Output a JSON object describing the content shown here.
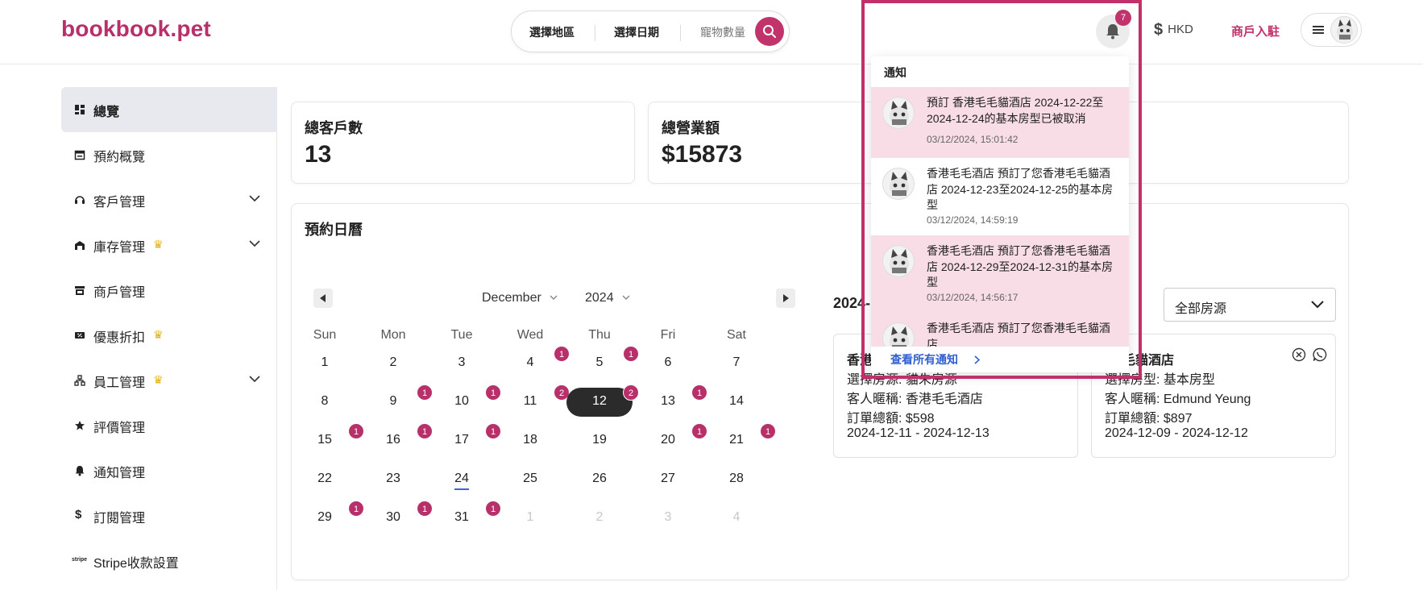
{
  "header": {
    "logo": "bookbook.pet",
    "search": {
      "region_label": "選擇地區",
      "date_label": "選擇日期",
      "pets_placeholder": "寵物數量"
    },
    "notification_count": "7",
    "currency": "HKD",
    "merchant_link": "商戶入駐"
  },
  "sidebar": {
    "items": [
      {
        "label": "總覽",
        "icon": "dashboard-icon",
        "active": true
      },
      {
        "label": "預約概覽",
        "icon": "calendar-icon"
      },
      {
        "label": "客戶管理",
        "icon": "headset-icon",
        "expandable": true
      },
      {
        "label": "庫存管理",
        "icon": "garage-icon",
        "premium": true,
        "expandable": true
      },
      {
        "label": "商戶管理",
        "icon": "store-icon"
      },
      {
        "label": "優惠折扣",
        "icon": "discount-icon",
        "premium": true
      },
      {
        "label": "員工管理",
        "icon": "org-icon",
        "premium": true,
        "expandable": true
      },
      {
        "label": "評價管理",
        "icon": "star-icon"
      },
      {
        "label": "通知管理",
        "icon": "bell-icon"
      },
      {
        "label": "訂閱管理",
        "icon": "dollar-icon"
      },
      {
        "label": "Stripe收款設置",
        "icon": "stripe-icon"
      }
    ]
  },
  "stats": {
    "customers_title": "總客戶數",
    "customers_value": "13",
    "revenue_title": "總營業額",
    "revenue_value": "$15873"
  },
  "calendar": {
    "title": "預約日曆",
    "month": "December",
    "year": "2024",
    "weekdays": [
      "Sun",
      "Mon",
      "Tue",
      "Wed",
      "Thu",
      "Fri",
      "Sat"
    ],
    "weeks": [
      [
        "1",
        "2",
        "3",
        "4",
        "5",
        "6",
        "7"
      ],
      [
        "8",
        "9",
        "10",
        "11",
        "12",
        "13",
        "14"
      ],
      [
        "15",
        "16",
        "17",
        "18",
        "19",
        "20",
        "21"
      ],
      [
        "22",
        "23",
        "24",
        "25",
        "26",
        "27",
        "28"
      ],
      [
        "29",
        "30",
        "31",
        "1",
        "2",
        "3",
        "4"
      ]
    ],
    "selected_day": "12",
    "today": "24",
    "badges": [
      {
        "day": "4",
        "count": "1"
      },
      {
        "day": "5",
        "count": "1"
      },
      {
        "day": "9",
        "count": "1"
      },
      {
        "day": "10",
        "count": "1"
      },
      {
        "day": "11",
        "count": "2"
      },
      {
        "day": "12",
        "count": "2"
      },
      {
        "day": "13",
        "count": "1"
      },
      {
        "day": "15",
        "count": "1"
      },
      {
        "day": "16",
        "count": "1"
      },
      {
        "day": "17",
        "count": "1"
      },
      {
        "day": "20",
        "count": "1"
      },
      {
        "day": "21",
        "count": "1"
      },
      {
        "day": "29",
        "count": "1"
      },
      {
        "day": "30",
        "count": "1"
      },
      {
        "day": "31",
        "count": "1"
      }
    ]
  },
  "bookings": {
    "date_label": "2024-",
    "room_filter": "全部房源",
    "cards": [
      {
        "title": "香港",
        "room": "選擇房源: 貓朱房源",
        "nickname": "客人暱稱: 香港毛毛酒店",
        "total": "訂單總額: $598",
        "range": "2024-12-11 - 2024-12-13"
      },
      {
        "title": "毛毛貓酒店",
        "room": "選擇房型: 基本房型",
        "nickname": "客人暱稱: Edmund Yeung",
        "total": "訂單總額: $897",
        "range": "2024-12-09 - 2024-12-12"
      }
    ]
  },
  "notifications": {
    "title": "通知",
    "items": [
      {
        "text": "預訂 香港毛毛貓酒店 2024-12-22至2024-12-24的基本房型已被取消",
        "time": "03/12/2024, 15:01:42",
        "unread": true
      },
      {
        "text": "香港毛毛酒店 預訂了您香港毛毛貓酒店 2024-12-23至2024-12-25的基本房型",
        "time": "03/12/2024, 14:59:19",
        "unread": false
      },
      {
        "text": "香港毛毛酒店 預訂了您香港毛毛貓酒店 2024-12-29至2024-12-31的基本房型",
        "time": "03/12/2024, 14:56:17",
        "unread": true
      },
      {
        "text": "香港毛毛酒店 預訂了您香港毛毛貓酒店",
        "time": "",
        "unread": true
      }
    ],
    "view_all": "查看所有通知"
  },
  "colors": {
    "brand": "#b8306a",
    "badge": "#b8306a",
    "unread_bg": "#f9dde6",
    "premium_crown": "#e2b21b",
    "link": "#2f5fcf"
  }
}
